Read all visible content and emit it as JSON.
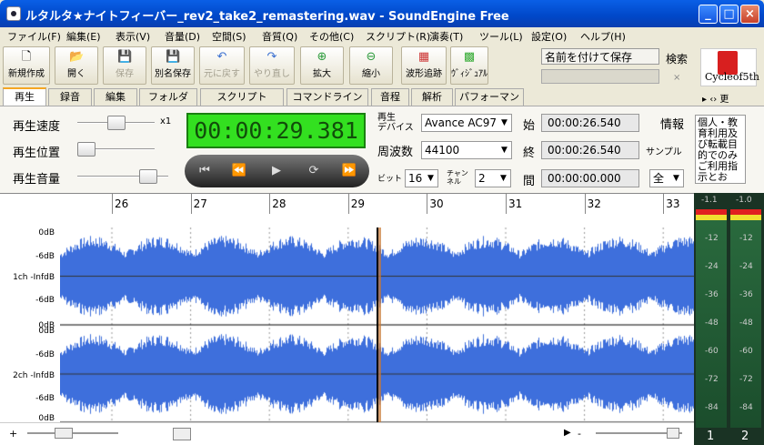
{
  "window": {
    "title": "ルタルタ★ナイトフィーバー_rev2_take2_remastering.wav - SoundEngine Free"
  },
  "menu": [
    "ファイル(F)",
    "編集(E)",
    "表示(V)",
    "音量(D)",
    "空間(S)",
    "音質(Q)",
    "その他(C)",
    "スクリプト(R)",
    "演奏(T)",
    "ツール(L)",
    "設定(O)",
    "ヘルプ(H)"
  ],
  "toolbar": {
    "new": "新規作成",
    "open": "開く",
    "save": "保存",
    "saveas": "別名保存",
    "undo": "元に戻す",
    "redo": "やり直し",
    "zoomin": "拡大",
    "zoomout": "縮小",
    "follow": "波形追跡",
    "visual": "ｳﾞｨｼﾞｭｱﾙ"
  },
  "namebox": "名前を付けて保存",
  "search_label": "検索",
  "search_clear": "×",
  "logo": {
    "text": "Cycleof5th"
  },
  "tabs": [
    "再生",
    "録音",
    "編集",
    "フォルダ",
    "スクリプト",
    "コマンドライン",
    "音程",
    "解析",
    "パフォーマンス"
  ],
  "tab_overflow": [
    "▸",
    "‹›",
    "更"
  ],
  "playback": {
    "speed": "再生速度",
    "position": "再生位置",
    "volume": "再生音量",
    "speed_mult": "x1",
    "speed_level": 0.5,
    "position_level": 0.0,
    "volume_level": 0.85,
    "time": "00:00:29.381",
    "device_label": "再生\nデバイス",
    "device": "Avance AC97",
    "freq_label": "周波数",
    "freq": "44100",
    "bit_label": "ビット",
    "bit": "16",
    "ch_label": "チャンネル",
    "ch": "2",
    "start_label": "始",
    "start": "00:00:26.540",
    "end_label": "終",
    "end": "00:00:26.540",
    "len_label": "間",
    "len": "00:00:00.000",
    "info": "情報",
    "sample": "サンプル",
    "all": "全",
    "notice": "個人・教育利用及び転載目的でのみご利用指示とお"
  },
  "transport": [
    "⏮",
    "⏪",
    "▶",
    "⟳",
    "⏩"
  ],
  "ruler": [
    "26",
    "27",
    "28",
    "29",
    "30",
    "31",
    "32",
    "33"
  ],
  "channels": [
    {
      "db_top": "0dB",
      "db_mid": "-6dB",
      "mid": "1ch -InfdB",
      "db_low": "-6dB",
      "db_bot": "0dB"
    },
    {
      "db_top": "0dB",
      "db_mid": "-6dB",
      "mid": "2ch -InfdB",
      "db_low": "-6dB",
      "db_bot": "0dB"
    }
  ],
  "meter": {
    "peak": [
      "-1.1",
      "-1.0"
    ],
    "levels": [
      "-12",
      "-24",
      "-36",
      "-48",
      "-60",
      "-72",
      "-84"
    ],
    "nums": [
      "1",
      "2"
    ]
  },
  "hscroll": {
    "plus": "+",
    "minus": "-"
  },
  "colors": {
    "wave": "#3e6fdc",
    "title": "#0047c8",
    "lcd": "#33e020"
  }
}
